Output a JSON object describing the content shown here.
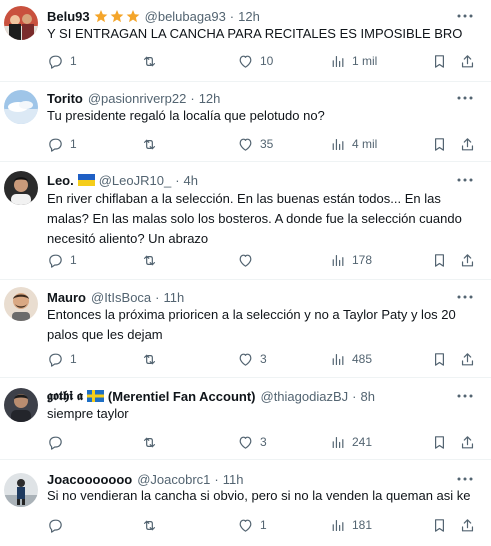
{
  "tweets": [
    {
      "name": "Belu93",
      "badge": "stars",
      "handle": "@belubaga93",
      "dot": "·",
      "time": "12h",
      "text": "Y SI ENTRAGAN LA CANCHA PARA RECITALES ES IMPOSIBLE BRO",
      "replies": "1",
      "retweets": "",
      "likes": "10",
      "views": "1 mil"
    },
    {
      "name": "Torito",
      "badge": "",
      "handle": "@pasionriverp22",
      "dot": "·",
      "time": "12h",
      "text": "Tu presidente regaló la localía que pelotudo no?",
      "replies": "1",
      "retweets": "",
      "likes": "35",
      "views": "4 mil"
    },
    {
      "name": "Leo.",
      "badge": "ukraine-flag",
      "handle": "@LeoJR10_",
      "dot": "·",
      "time": "4h",
      "text": "En river chiflaban a la selección. En las buenas están todos... En las malas? En las malas solo los bosteros. A donde fue la selección cuando necesitó aliento? Un abrazo",
      "replies": "1",
      "retweets": "",
      "likes": "",
      "views": "178"
    },
    {
      "name": "Mauro",
      "badge": "",
      "handle": "@ItIsBoca",
      "dot": "·",
      "time": "11h",
      "text": "Entonces la próxima prioricen a la selección y no a Taylor Paty y los 20 palos que les dejam",
      "replies": "1",
      "retweets": "",
      "likes": "3",
      "views": "485"
    },
    {
      "name": "𝖌𝖔𝖙𝖍𝖎 𝖆",
      "badge": "sweden-flag",
      "suffix": "(Merentiel Fan Account)",
      "handle": "@thiagodiazBJ",
      "dot": "·",
      "time": "8h",
      "text": "siempre taylor",
      "replies": "",
      "retweets": "",
      "likes": "3",
      "views": "241"
    },
    {
      "name": "Joacooooooo",
      "badge": "",
      "handle": "@Joacobrc1",
      "dot": "·",
      "time": "11h",
      "text": "Si no vendieran la cancha si obvio, pero si no la venden la queman asi ke",
      "replies": "",
      "retweets": "",
      "likes": "1",
      "views": "181"
    }
  ],
  "icons": {
    "more": "more-dots-icon",
    "reply": "reply-icon",
    "retweet": "retweet-icon",
    "like": "heart-icon",
    "views": "views-chart-icon",
    "bookmark": "bookmark-icon",
    "share": "share-icon"
  },
  "colors": {
    "text": "#0f1419",
    "secondary": "#536471",
    "divider": "#eff3f4",
    "star": "#f4a52a"
  }
}
